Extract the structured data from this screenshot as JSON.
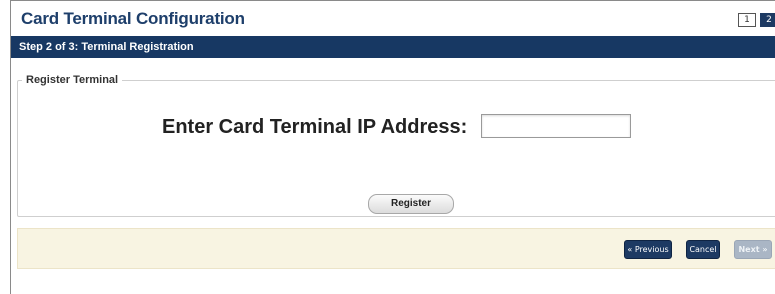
{
  "header": {
    "title": "Card Terminal Configuration",
    "steps": [
      "1",
      "2"
    ]
  },
  "step_bar": {
    "text": "Step 2 of 3: Terminal Registration"
  },
  "register_section": {
    "legend": "Register Terminal",
    "ip_label": "Enter Card Terminal IP Address:",
    "ip_value": "",
    "ip_placeholder": "",
    "register_button": "Register"
  },
  "footer": {
    "previous_label": "« Previous",
    "cancel_label": "Cancel",
    "next_label": "Next »"
  },
  "colors": {
    "accent": "#173863",
    "footer_bg": "#f8f4e2"
  }
}
